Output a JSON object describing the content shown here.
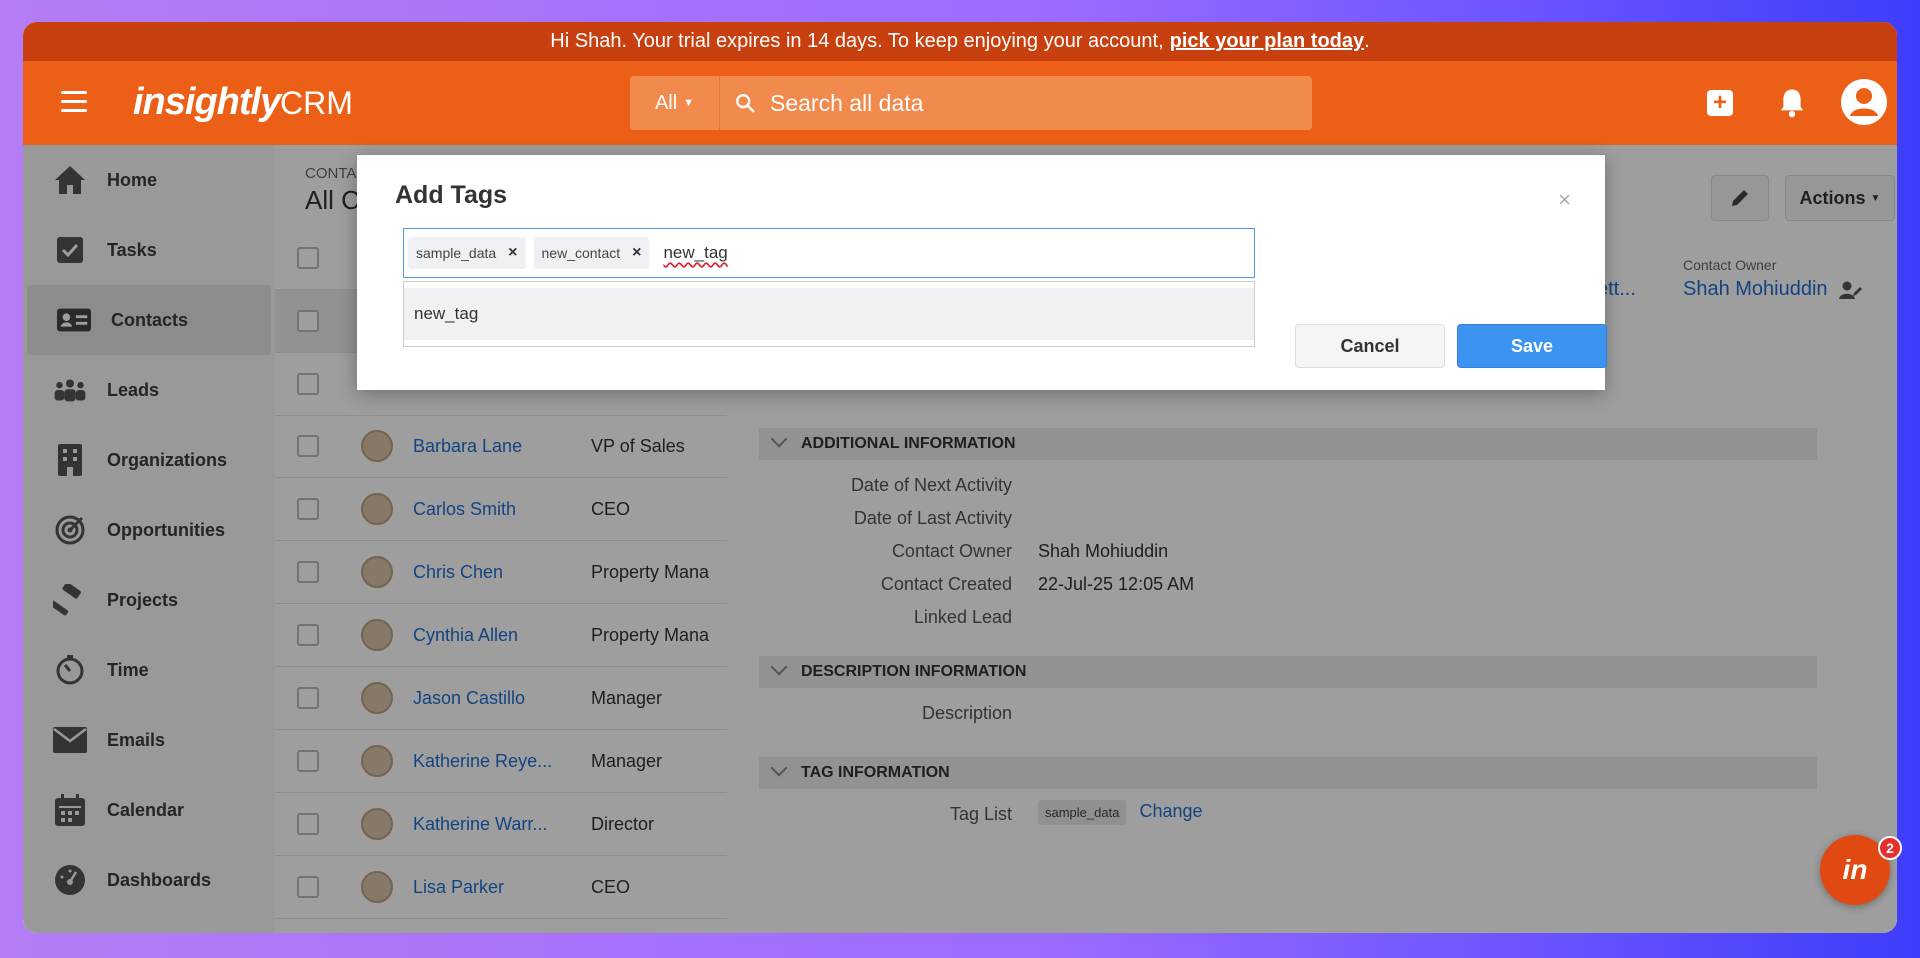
{
  "banner": {
    "text": "Hi Shah. Your trial expires in 14 days. To keep enjoying your account,",
    "link": "pick your plan today",
    "end": "."
  },
  "header": {
    "logo": "insightly",
    "product": "CRM",
    "search_scope": "All",
    "search_placeholder": "Search all data",
    "icons": [
      "menu-icon",
      "add-icon",
      "bell-icon",
      "user-icon"
    ]
  },
  "sidebar": {
    "items": [
      {
        "label": "Home",
        "icon": "home-icon"
      },
      {
        "label": "Tasks",
        "icon": "checkbox-icon"
      },
      {
        "label": "Contacts",
        "icon": "contact-card-icon",
        "active": true
      },
      {
        "label": "Leads",
        "icon": "people-icon"
      },
      {
        "label": "Organizations",
        "icon": "building-icon"
      },
      {
        "label": "Opportunities",
        "icon": "target-icon"
      },
      {
        "label": "Projects",
        "icon": "hammer-icon"
      },
      {
        "label": "Time",
        "icon": "timer-icon"
      },
      {
        "label": "Emails",
        "icon": "envelope-icon"
      },
      {
        "label": "Calendar",
        "icon": "calendar-icon"
      },
      {
        "label": "Dashboards",
        "icon": "gauge-icon"
      }
    ]
  },
  "list": {
    "subtitle": "CONTA",
    "title": "All C",
    "rows": [
      {
        "name": "Barbara Lane",
        "title": "VP of Sales"
      },
      {
        "name": "Carlos Smith",
        "title": "CEO"
      },
      {
        "name": "Chris Chen",
        "title": "Property Mana"
      },
      {
        "name": "Cynthia Allen",
        "title": "Property Mana"
      },
      {
        "name": "Jason Castillo",
        "title": "Manager"
      },
      {
        "name": "Katherine Reye...",
        "title": "Manager"
      },
      {
        "name": "Katherine Warr...",
        "title": "Director"
      },
      {
        "name": "Lisa Parker",
        "title": "CEO"
      }
    ]
  },
  "detail": {
    "actions_label": "Actions",
    "linked_fragment": "ett...",
    "owner_label": "Contact Owner",
    "owner_value": "Shah Mohiuddin",
    "sections": {
      "additional": "ADDITIONAL INFORMATION",
      "description": "DESCRIPTION INFORMATION",
      "tags": "TAG INFORMATION"
    },
    "fields": {
      "next_activity": "Date of Next Activity",
      "last_activity": "Date of Last Activity",
      "contact_owner": "Contact Owner",
      "contact_owner_val": "Shah Mohiuddin",
      "contact_created": "Contact Created",
      "contact_created_val": "22-Jul-25 12:05 AM",
      "linked_lead": "Linked Lead",
      "description": "Description",
      "tag_list": "Tag List",
      "tag_chip": "sample_data",
      "change": "Change"
    }
  },
  "modal": {
    "title": "Add Tags",
    "close": "×",
    "tags": [
      "sample_data",
      "new_contact"
    ],
    "typed": "new_tag",
    "suggestion": "new_tag",
    "cancel": "Cancel",
    "save": "Save"
  },
  "chat": {
    "label": "in",
    "badge": "2"
  }
}
